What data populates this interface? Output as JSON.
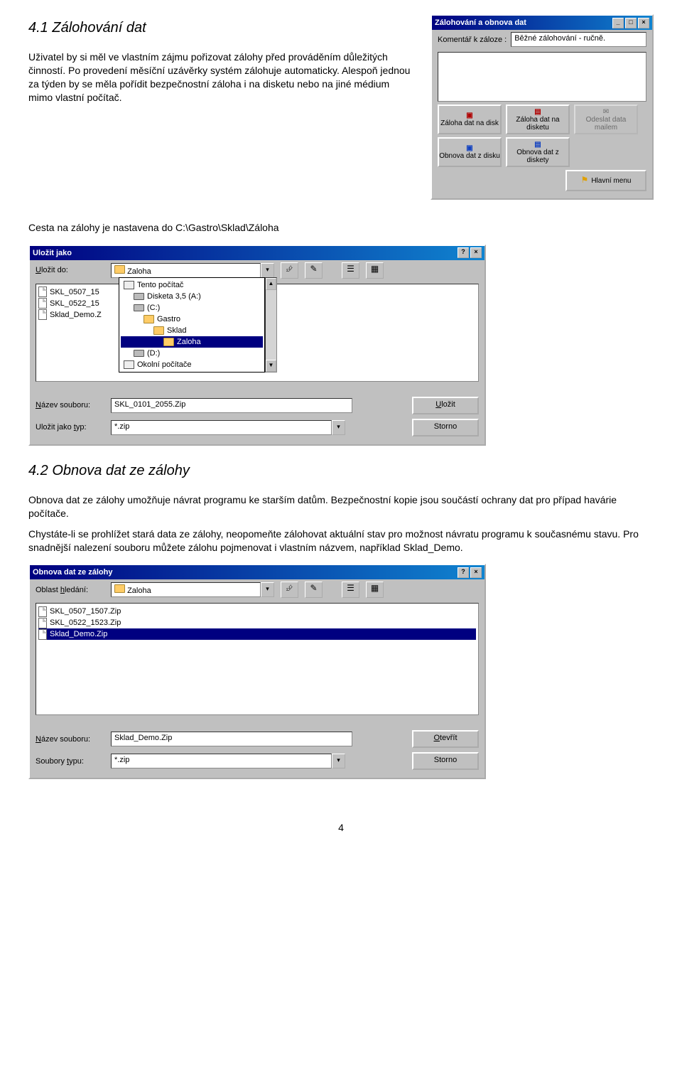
{
  "doc": {
    "h1": "4.1   Zálohování dat",
    "p1": "Uživatel by si měl ve vlastním zájmu pořizovat zálohy před prováděním důležitých činností. Po provedení měsíční uzávěrky systém zálohuje automaticky. Alespoň jednou za týden by se měla pořídit bezpečnostní záloha i na disketu nebo na jiné médium mimo vlastní počítač.",
    "p_cesta": "Cesta na zálohy je nastavena do C:\\Gastro\\Sklad\\Záloha",
    "h2": "4.2   Obnova dat ze zálohy",
    "p2": "Obnova dat ze zálohy umožňuje návrat programu ke starším datům. Bezpečnostní kopie jsou součástí ochrany dat pro případ havárie počítače.",
    "p3": "Chystáte-li se prohlížet stará data ze zálohy, neopomeňte zálohovat aktuální stav pro možnost návratu programu k současnému stavu.  Pro snadnější nalezení souboru můžete zálohu pojmenovat i vlastním názvem, například Sklad_Demo.",
    "pagenum": "4"
  },
  "backupWin": {
    "title": "Zálohování a obnova dat",
    "label_comment": "Komentář k záloze :",
    "comment_value": "Běžné zálohování - ručně.",
    "btn_zaloha_disk": "Záloha dat na disk",
    "btn_zaloha_disketu": "Záloha dat na disketu",
    "btn_odeslat": "Odeslat data mailem",
    "btn_obnova_disk": "Obnova dat z disku",
    "btn_obnova_diskety": "Obnova dat z diskety",
    "btn_hlavni_menu": "Hlavní menu"
  },
  "saveDlg": {
    "title": "Uložit jako",
    "lbl_ulozit_do": "Uložit do:",
    "combo_value": "Zaloha",
    "tree": {
      "pc": "Tento počítač",
      "floppy": "Disketa 3,5 (A:)",
      "c": "(C:)",
      "gastro": "Gastro",
      "sklad": "Sklad",
      "zaloha": "Zaloha",
      "d": "(D:)",
      "okolni": "Okolní počítače"
    },
    "files": [
      "SKL_0507_15",
      "SKL_0522_15",
      "Sklad_Demo.Z"
    ],
    "lbl_nazev": "Název souboru:",
    "nazev_value": "SKL_0101_2055.Zip",
    "lbl_typ": "Uložit jako typ:",
    "typ_value": "*.zip",
    "btn_save": "Uložit",
    "btn_cancel": "Storno"
  },
  "openDlg": {
    "title": "Obnova dat ze zálohy",
    "lbl_oblast": "Oblast hledání:",
    "combo_value": "Zaloha",
    "files": [
      "SKL_0507_1507.Zip",
      "SKL_0522_1523.Zip",
      "Sklad_Demo.Zip"
    ],
    "lbl_nazev": "Název souboru:",
    "nazev_value": "Sklad_Demo.Zip",
    "lbl_typ": "Soubory typu:",
    "typ_value": "*.zip",
    "btn_open": "Otevřít",
    "btn_cancel": "Storno"
  }
}
